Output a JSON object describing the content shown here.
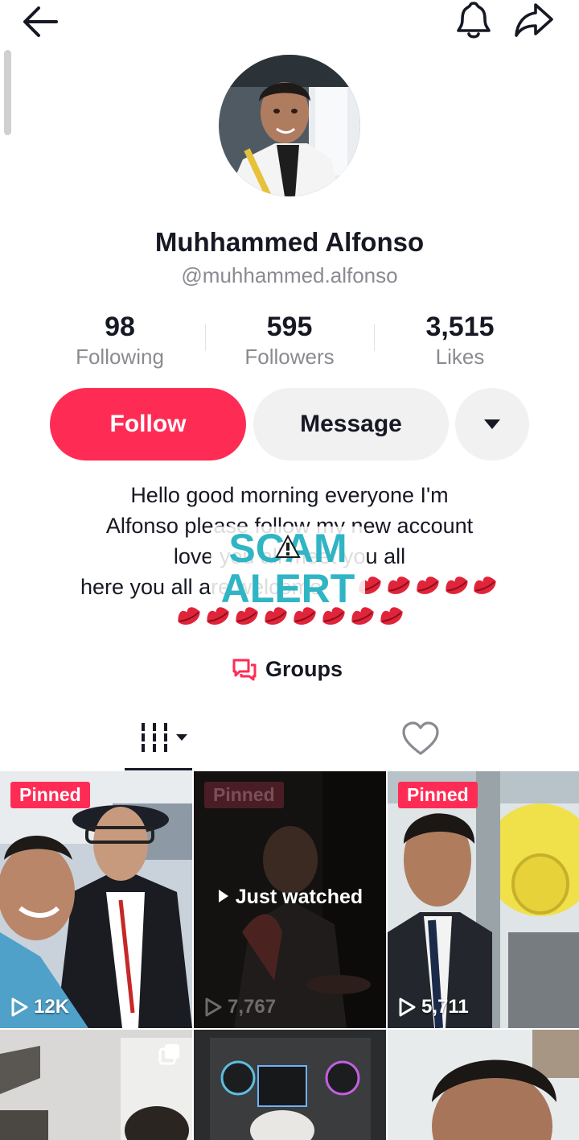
{
  "profile": {
    "name": "Muhhammed Alfonso",
    "handle": "@muhhammed.alfonso"
  },
  "stats": [
    {
      "value": "98",
      "label": "Following"
    },
    {
      "value": "595",
      "label": "Followers"
    },
    {
      "value": "3,515",
      "label": "Likes"
    }
  ],
  "actions": {
    "follow_label": "Follow",
    "message_label": "Message"
  },
  "bio": {
    "lines": [
      "Hello good morning everyone I'm",
      "Alfonso please follow my new account",
      "love you all meet you all",
      "here you all are welcome"
    ]
  },
  "sticker": {
    "line1": "SCAM",
    "line2": "ALERT"
  },
  "groups": {
    "label": "Groups"
  },
  "videos": [
    {
      "pinned": "Pinned",
      "views": "12K"
    },
    {
      "pinned": "Pinned",
      "views": "7,767",
      "overlay": "Just watched"
    },
    {
      "pinned": "Pinned",
      "views": "5,711"
    },
    {},
    {},
    {}
  ],
  "colors": {
    "accent": "#fe2c55",
    "secondary_button": "#f1f1f2",
    "muted_text": "#8a8b91",
    "primary_text": "#161823"
  },
  "icons": {
    "back": "arrow-left-icon",
    "notifications": "bell-icon",
    "share": "share-arrow-icon",
    "more": "caret-down-icon",
    "groups": "chat-bubbles-icon",
    "videos_tab": "grid-bars-icon",
    "liked_tab": "heart-outline-icon",
    "play": "play-outline-icon",
    "multi": "multi-photo-icon"
  }
}
